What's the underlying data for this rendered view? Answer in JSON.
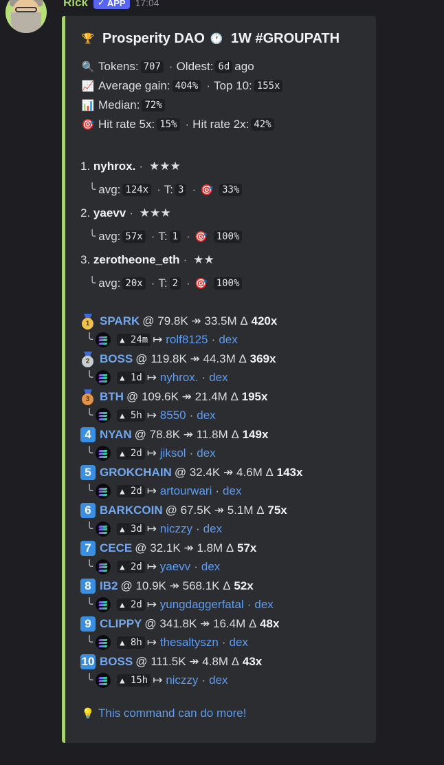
{
  "header": {
    "username": "Rick",
    "app_badge": "APP",
    "app_check": "✓",
    "timestamp": "17:04"
  },
  "embed": {
    "title": "Prosperity DAO",
    "title_suffix": "1W #GROUPATH",
    "stats": {
      "tokens_label": "Tokens:",
      "tokens_value": "707",
      "oldest_label": "Oldest:",
      "oldest_value": "6d",
      "oldest_suffix": "ago",
      "avg_gain_label": "Average gain:",
      "avg_gain_value": "404%",
      "top10_label": "Top 10:",
      "top10_value": "155x",
      "median_label": "Median:",
      "median_value": "72%",
      "hit5_label": "Hit rate 5x:",
      "hit5_value": "15%",
      "hit2_label": "Hit rate 2x:",
      "hit2_value": "42%"
    },
    "leaders": [
      {
        "rank": "1.",
        "name": "nyhrox.",
        "stars": "★★★",
        "avg": "124x",
        "t": "3",
        "hit": "33%"
      },
      {
        "rank": "2.",
        "name": "yaevv",
        "stars": "★★★",
        "avg": "57x",
        "t": "1",
        "hit": "100%"
      },
      {
        "rank": "3.",
        "name": "zerotheone_eth",
        "stars": "★★",
        "avg": "20x",
        "t": "2",
        "hit": "100%"
      }
    ],
    "labels": {
      "avg": "avg:",
      "t": "T:",
      "dex": "dex",
      "delta": "Δ",
      "at": "@",
      "arrow": "↠",
      "mapsto": "↦"
    },
    "tokens": [
      {
        "rank": "1",
        "ticker": "SPARK",
        "from": "79.8K",
        "to": "33.5M",
        "mult": "420x",
        "age": "24m",
        "caller": "rolf8125"
      },
      {
        "rank": "2",
        "ticker": "BOSS",
        "from": "119.8K",
        "to": "44.3M",
        "mult": "369x",
        "age": "1d",
        "caller": "nyhrox."
      },
      {
        "rank": "3",
        "ticker": "BTH",
        "from": "109.6K",
        "to": "21.4M",
        "mult": "195x",
        "age": "5h",
        "caller": "8550"
      },
      {
        "rank": "4",
        "ticker": "NYAN",
        "from": "78.8K",
        "to": "11.8M",
        "mult": "149x",
        "age": "2d",
        "caller": "jiksol"
      },
      {
        "rank": "5",
        "ticker": "GROKCHAIN",
        "from": "32.4K",
        "to": "4.6M",
        "mult": "143x",
        "age": "2d",
        "caller": "artourwari"
      },
      {
        "rank": "6",
        "ticker": "BARKCOIN",
        "from": "67.5K",
        "to": "5.1M",
        "mult": "75x",
        "age": "3d",
        "caller": "niczzy"
      },
      {
        "rank": "7",
        "ticker": "CECE",
        "from": "32.1K",
        "to": "1.8M",
        "mult": "57x",
        "age": "2d",
        "caller": "yaevv"
      },
      {
        "rank": "8",
        "ticker": "IB2",
        "from": "10.9K",
        "to": "568.1K",
        "mult": "52x",
        "age": "2d",
        "caller": "yungdaggerfatal"
      },
      {
        "rank": "9",
        "ticker": "CLIPPY",
        "from": "341.8K",
        "to": "16.4M",
        "mult": "48x",
        "age": "8h",
        "caller": "thesaltyszn"
      },
      {
        "rank": "10",
        "ticker": "BOSS",
        "from": "111.5K",
        "to": "4.8M",
        "mult": "43x",
        "age": "15h",
        "caller": "niczzy"
      }
    ],
    "footer": "This command can do more!"
  },
  "colors": {
    "accent": "#a6d36b",
    "link": "#5d9cf0",
    "ticker": "#73a8ee",
    "badge": "#5865f2"
  },
  "icons": [
    "trophy-icon",
    "clock-icon",
    "magnifier-icon",
    "chart-up-icon",
    "bar-chart-icon",
    "target-icon",
    "medal-icon",
    "solana-icon",
    "lightbulb-icon"
  ]
}
